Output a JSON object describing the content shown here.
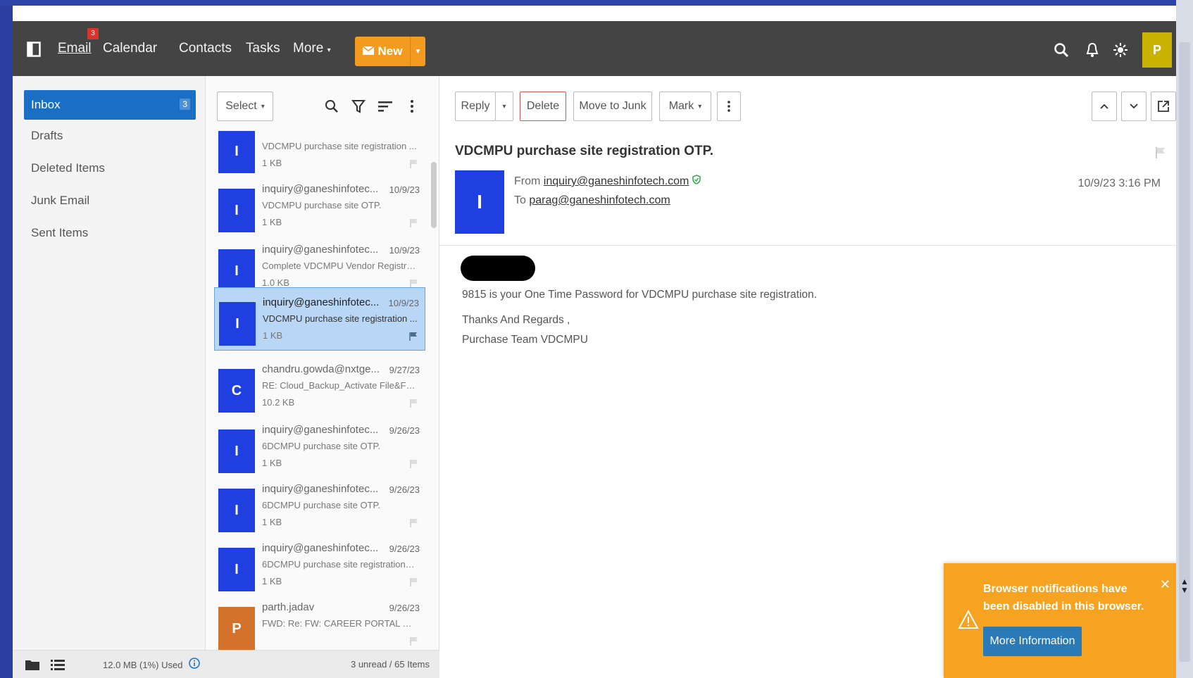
{
  "nav": {
    "items": [
      "Email",
      "Calendar",
      "Contacts",
      "Tasks",
      "More"
    ],
    "email_badge": "3",
    "new_label": "New",
    "user_initial": "P"
  },
  "folders": {
    "items": [
      {
        "label": "Inbox",
        "count": "3"
      },
      {
        "label": "Drafts"
      },
      {
        "label": "Deleted Items"
      },
      {
        "label": "Junk Email"
      },
      {
        "label": "Sent Items"
      }
    ],
    "storage": "12.0 MB (1%) Used"
  },
  "list": {
    "select_label": "Select",
    "footer": "3 unread / 65 Items",
    "messages": [
      {
        "initial": "I",
        "from": "",
        "date": "",
        "subject": "VDCMPU purchase site registration ...",
        "size": "1 KB"
      },
      {
        "initial": "I",
        "from": "inquiry@ganeshinfotec...",
        "date": "10/9/23",
        "subject": "VDCMPU purchase site OTP.",
        "size": "1 KB"
      },
      {
        "initial": "I",
        "from": "inquiry@ganeshinfotec...",
        "date": "10/9/23",
        "subject": "Complete VDCMPU Vendor Registrat...",
        "size": "1.0 KB"
      },
      {
        "initial": "I",
        "from": "inquiry@ganeshinfotec...",
        "date": "10/9/23",
        "subject": "VDCMPU purchase site registration ...",
        "size": "1 KB",
        "selected": true
      },
      {
        "initial": "C",
        "from": "chandru.gowda@nxtge...",
        "date": "9/27/23",
        "subject": "RE: Cloud_Backup_Activate File&Fold...",
        "size": "10.2 KB"
      },
      {
        "initial": "I",
        "from": "inquiry@ganeshinfotec...",
        "date": "9/26/23",
        "subject": "6DCMPU purchase site OTP.",
        "size": "1 KB"
      },
      {
        "initial": "I",
        "from": "inquiry@ganeshinfotec...",
        "date": "9/26/23",
        "subject": "6DCMPU purchase site OTP.",
        "size": "1 KB"
      },
      {
        "initial": "I",
        "from": "inquiry@ganeshinfotec...",
        "date": "9/26/23",
        "subject": "6DCMPU purchase site registration O...",
        "size": "1 KB"
      },
      {
        "initial": "P",
        "from": "parth.jadav",
        "date": "9/26/23",
        "subject": "FWD: Re: FW: CAREER PORTAL DEVEL...",
        "size": "",
        "orange": true
      }
    ]
  },
  "reader": {
    "toolbar": {
      "reply": "Reply",
      "delete": "Delete",
      "junk": "Move to Junk",
      "mark": "Mark"
    },
    "subject": "VDCMPU purchase site registration OTP.",
    "sender_initial": "I",
    "from_label": "From",
    "from_addr": "inquiry@ganeshinfotech.com",
    "to_label": "To",
    "to_addr": "parag@ganeshinfotech.com",
    "received": "10/9/23 3:16 PM",
    "body": {
      "line1": "9815 is your One Time Password for VDCMPU purchase site registration.",
      "line2": "Thanks And Regards ,",
      "line3": "Purchase Team VDCMPU"
    }
  },
  "toast": {
    "message": "Browser notifications have been disabled in this browser.",
    "button": "More Information"
  },
  "colors": {
    "accent": "#1a6fc4",
    "new_button": "#f39b1f",
    "avatar": "#1f3fe0",
    "toast": "#f5a321"
  }
}
